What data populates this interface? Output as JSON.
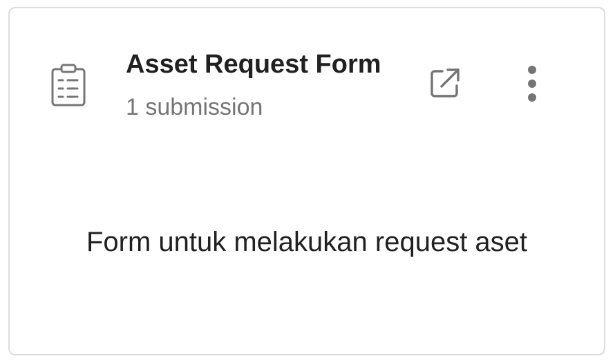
{
  "card": {
    "title": "Asset Request Form",
    "subtitle": "1 submission",
    "description": "Form untuk melakukan request aset",
    "icons": {
      "form": "clipboard-list-icon",
      "open": "external-link-icon",
      "more": "more-vertical-icon"
    }
  },
  "colors": {
    "title": "#212121",
    "subtitle": "#757575",
    "icon": "#757575",
    "border": "#dcdcdc"
  }
}
